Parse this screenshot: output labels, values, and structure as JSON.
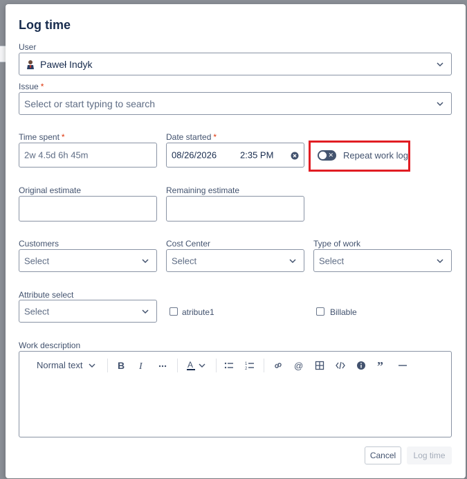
{
  "dialog": {
    "title": "Log time"
  },
  "fields": {
    "user": {
      "label": "User",
      "value": "Paweł Indyk"
    },
    "issue": {
      "label": "Issue",
      "required_mark": "*",
      "placeholder": "Select or start typing to search"
    },
    "time_spent": {
      "label": "Time spent",
      "required_mark": "*",
      "placeholder": "2w 4.5d 6h 45m"
    },
    "date_started": {
      "label": "Date started",
      "required_mark": "*",
      "date": "08/26/2026",
      "time": "2:35 PM"
    },
    "repeat_work_log": {
      "label": "Repeat work log",
      "enabled": false
    },
    "original_estimate": {
      "label": "Original estimate",
      "value": ""
    },
    "remaining_estimate": {
      "label": "Remaining estimate",
      "value": ""
    },
    "customers": {
      "label": "Customers",
      "value": "Select"
    },
    "cost_center": {
      "label": "Cost Center",
      "value": "Select"
    },
    "type_of_work": {
      "label": "Type of work",
      "value": "Select"
    },
    "attribute_select": {
      "label": "Attribute select",
      "value": "Select"
    },
    "atribute1": {
      "label": "atribute1",
      "checked": false
    },
    "billable": {
      "label": "Billable",
      "checked": false
    },
    "work_description": {
      "label": "Work description",
      "value": ""
    }
  },
  "editor_toolbar": {
    "text_style": "Normal text",
    "icons": [
      "bold-icon",
      "italic-icon",
      "more-formatting-icon",
      "text-color-icon",
      "bullet-list-icon",
      "numbered-list-icon",
      "link-icon",
      "mention-icon",
      "table-icon",
      "code-icon",
      "info-panel-icon",
      "quote-icon",
      "divider-icon"
    ]
  },
  "actions": {
    "cancel": "Cancel",
    "submit": "Log time"
  },
  "colors": {
    "highlight": "#e11d23",
    "required": "#de350b",
    "text": "#172b4d",
    "border": "#8993a4"
  }
}
